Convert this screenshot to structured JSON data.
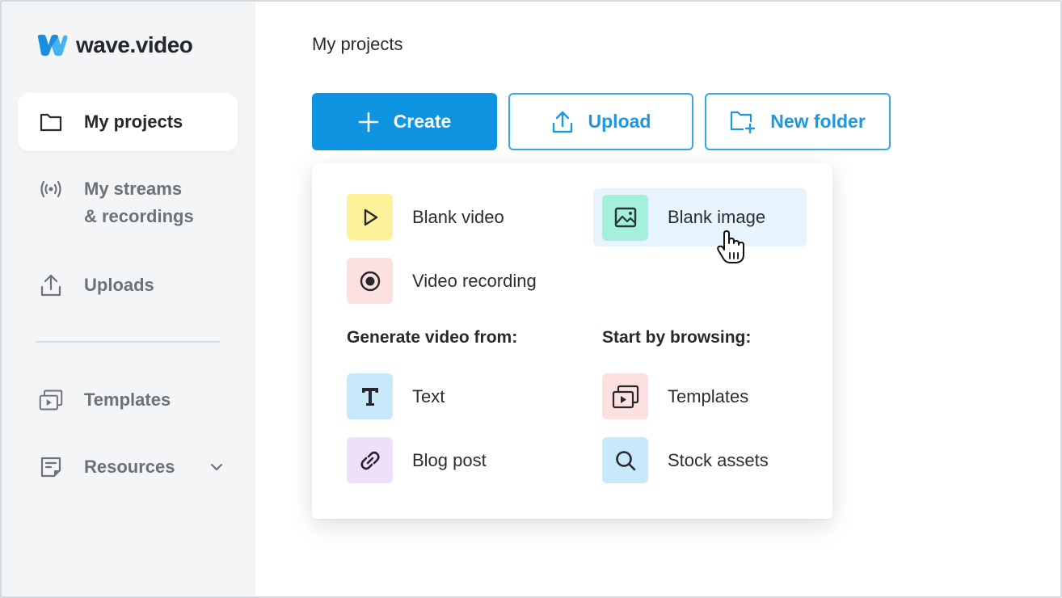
{
  "app": {
    "brand": "wave.video",
    "brand_color": "#1a8fe0",
    "accent_color": "#0e94e0"
  },
  "sidebar": {
    "items": [
      {
        "label": "My projects",
        "icon": "folder-icon",
        "active": true
      },
      {
        "label": "My streams",
        "label_line2": "& recordings",
        "icon": "broadcast-icon",
        "active": false
      },
      {
        "label": "Uploads",
        "icon": "upload-icon",
        "active": false
      },
      {
        "label": "Templates",
        "icon": "templates-icon",
        "active": false
      },
      {
        "label": "Resources",
        "icon": "resources-icon",
        "active": false,
        "has_dropdown": true
      }
    ]
  },
  "main": {
    "title": "My projects",
    "buttons": {
      "create": "Create",
      "upload": "Upload",
      "new_folder": "New folder"
    }
  },
  "create_menu": {
    "blank_items": [
      {
        "label": "Blank video",
        "icon": "play-icon",
        "tile_color": "#fbf29a"
      },
      {
        "label": "Blank image",
        "icon": "image-icon",
        "tile_color": "#a5f0da",
        "hovered": true
      },
      {
        "label": "Video recording",
        "icon": "record-icon",
        "tile_color": "#fde0e0"
      }
    ],
    "generate_section": {
      "title": "Generate video from:",
      "items": [
        {
          "label": "Text",
          "icon": "text-icon",
          "tile_color": "#c8e8fb"
        },
        {
          "label": "Blog post",
          "icon": "link-icon",
          "tile_color": "#efdff9"
        }
      ]
    },
    "browse_section": {
      "title": "Start by browsing:",
      "items": [
        {
          "label": "Templates",
          "icon": "templates-icon",
          "tile_color": "#fde0e0"
        },
        {
          "label": "Stock assets",
          "icon": "search-icon",
          "tile_color": "#c8e8fb"
        }
      ]
    }
  }
}
